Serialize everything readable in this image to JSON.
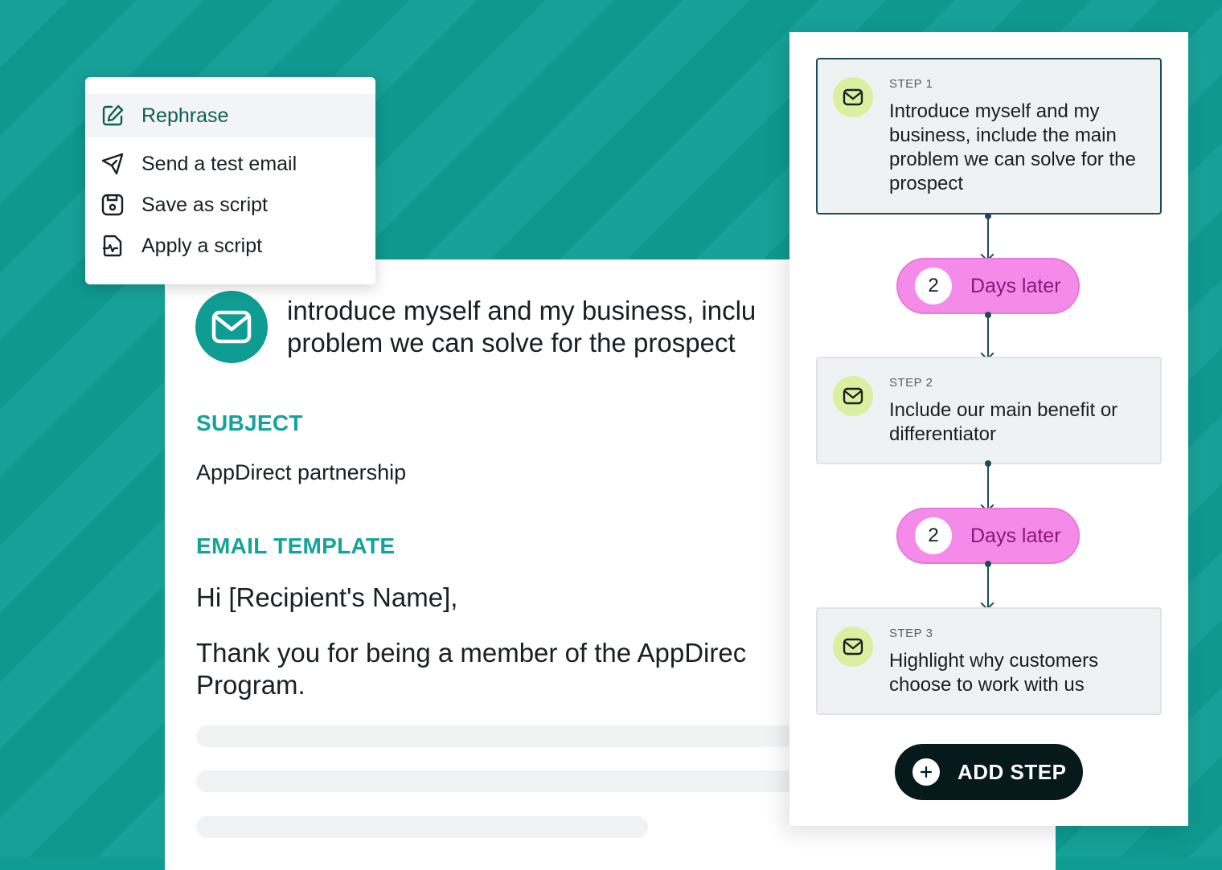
{
  "menu": {
    "items": [
      {
        "label": "Rephrase",
        "icon": "edit-icon"
      },
      {
        "label": "Send a test email",
        "icon": "send-icon"
      },
      {
        "label": "Save as script",
        "icon": "save-icon"
      },
      {
        "label": "Apply a script",
        "icon": "apply-script-icon"
      }
    ]
  },
  "editor": {
    "headline_line1": "introduce myself and my business, inclu",
    "headline_line2": "problem we can solve for the prospect",
    "subject_label": "SUBJECT",
    "subject_value": "AppDirect partnership",
    "template_label": "EMAIL TEMPLATE",
    "greeting": "Hi [Recipient's Name],",
    "body_line1": "Thank you for being a member of the AppDirec",
    "body_line2": "Program."
  },
  "sequence": {
    "steps": [
      {
        "label": "STEP 1",
        "text": "Introduce myself and my business, include the main problem we can solve for the prospect"
      },
      {
        "label": "STEP 2",
        "text": "Include our main benefit or differentiator"
      },
      {
        "label": "STEP 3",
        "text": "Highlight why customers choose to work with us"
      }
    ],
    "delays": [
      {
        "number": "2",
        "text": "Days later"
      },
      {
        "number": "2",
        "text": "Days later"
      }
    ],
    "add_step_label": "ADD STEP"
  },
  "colors": {
    "background": "#0f9d93",
    "accent": "#14a39a",
    "delay_pill": "#f58be8",
    "step_icon_bg": "#d9f0a0",
    "add_button": "#06191b"
  }
}
